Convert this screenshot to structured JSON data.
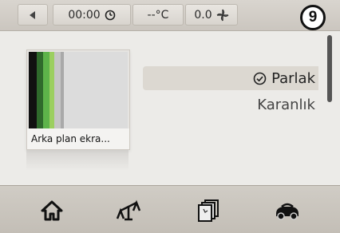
{
  "status_bar": {
    "back_icon": "left-triangle-icon",
    "clock": "00:00",
    "clock_icon": "clock-icon",
    "temperature": "--°C",
    "fan_value": "0.0",
    "fan_icon": "fan-icon"
  },
  "annotation_badge": "9",
  "thumbnail": {
    "caption": "Arka plan ekra...",
    "stripe_colors": [
      "#111111",
      "#2f6a2c",
      "#5db34a",
      "#9ccf60",
      "#c6c6c6",
      "#a9a9a9"
    ]
  },
  "options": [
    {
      "label": "Parlak",
      "selected": true
    },
    {
      "label": "Karanlık",
      "selected": false
    }
  ],
  "nav": [
    {
      "name": "home",
      "icon": "home-icon"
    },
    {
      "name": "scale",
      "icon": "scale-icon"
    },
    {
      "name": "media",
      "icon": "media-icon"
    },
    {
      "name": "car",
      "icon": "car-icon"
    }
  ],
  "colors": {
    "background": "#ecebe8",
    "selected_row": "#dcd8d1",
    "bar": "#cbc6bf"
  }
}
